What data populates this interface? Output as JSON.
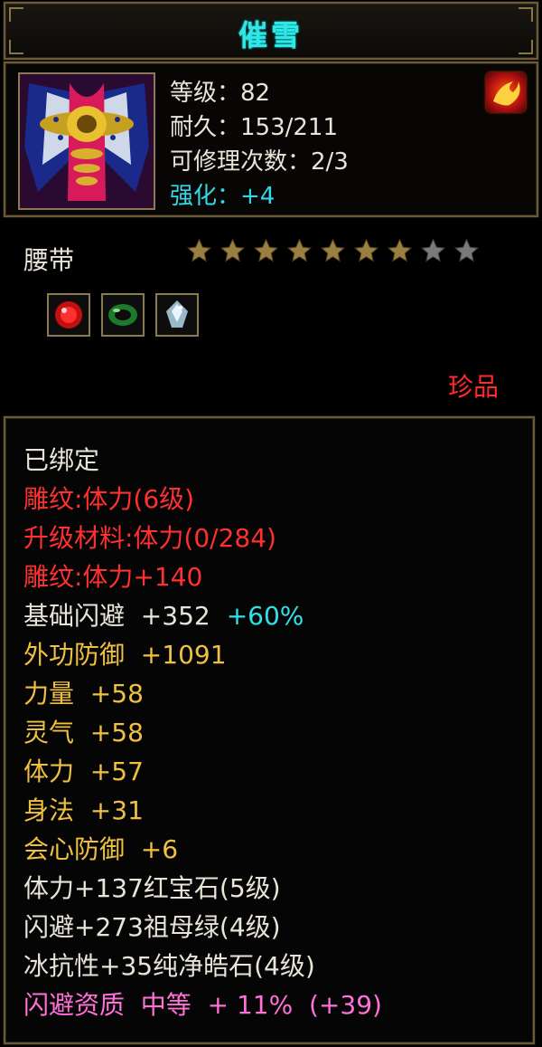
{
  "item": {
    "name": "催雪",
    "level_line": "等级：82",
    "durability_line": "耐久：153/211",
    "repair_line": "可修理次数：2/3",
    "enhance_line": "强化：+4",
    "type": "腰带",
    "stars_filled": 7,
    "stars_total": 9,
    "rarity": "珍品"
  },
  "gems": [
    {
      "name": "red-gem-icon",
      "color": "#e02020"
    },
    {
      "name": "green-jade-icon",
      "color": "#2a9a3a"
    },
    {
      "name": "white-crystal-icon",
      "color": "#b0d0e0"
    }
  ],
  "details": {
    "bound": "已绑定",
    "engrave1": "雕纹:体力(6级)",
    "upgrade_mat": "升级材料:体力(0/284)",
    "engrave2": "雕纹:体力+140",
    "base_dodge_label": "基础闪避  +352",
    "base_dodge_bonus": "+60%",
    "ext_def": "外功防御  +1091",
    "strength": "力量  +58",
    "spirit": "灵气  +58",
    "vitality": "体力  +57",
    "agility": "身法  +31",
    "crit_def": "会心防御  +6",
    "gem1": "体力+137红宝石(5级)",
    "gem2": "闪避+273祖母绿(4级)",
    "gem3": "冰抗性+35纯净皓石(4级)",
    "quality": "闪避资质  中等  + 11%  (+39)"
  }
}
